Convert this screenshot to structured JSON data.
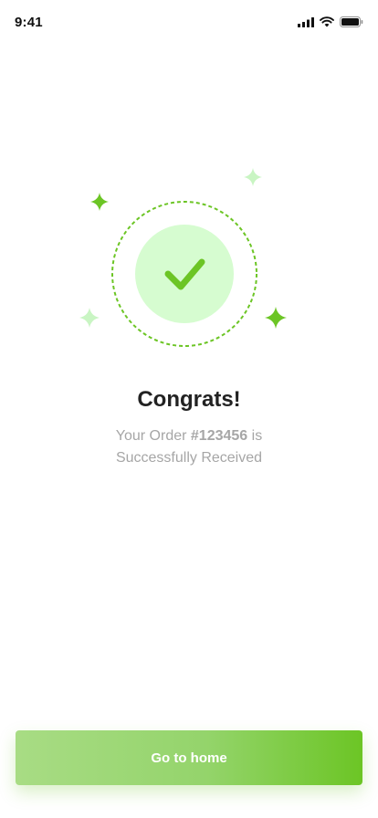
{
  "status_bar": {
    "time": "9:41",
    "icons": [
      "signal-icon",
      "wifi-icon",
      "battery-icon"
    ]
  },
  "confirmation": {
    "title": "Congrats!",
    "message_prefix": "Your Order",
    "order_number": "#123456",
    "message_suffix": "is",
    "message_line2": "Successfully Received",
    "icon": "checkmark-icon",
    "decorations": [
      "sparkle-icon",
      "sparkle-icon",
      "sparkle-icon",
      "sparkle-icon"
    ]
  },
  "actions": {
    "home_label": "Go to home"
  },
  "colors": {
    "accent": "#6cc525",
    "accent_light": "#d6fcd0",
    "sparkle_light": "#c9f5c3",
    "text_dark": "#222222",
    "text_muted": "#a6a6a6"
  }
}
